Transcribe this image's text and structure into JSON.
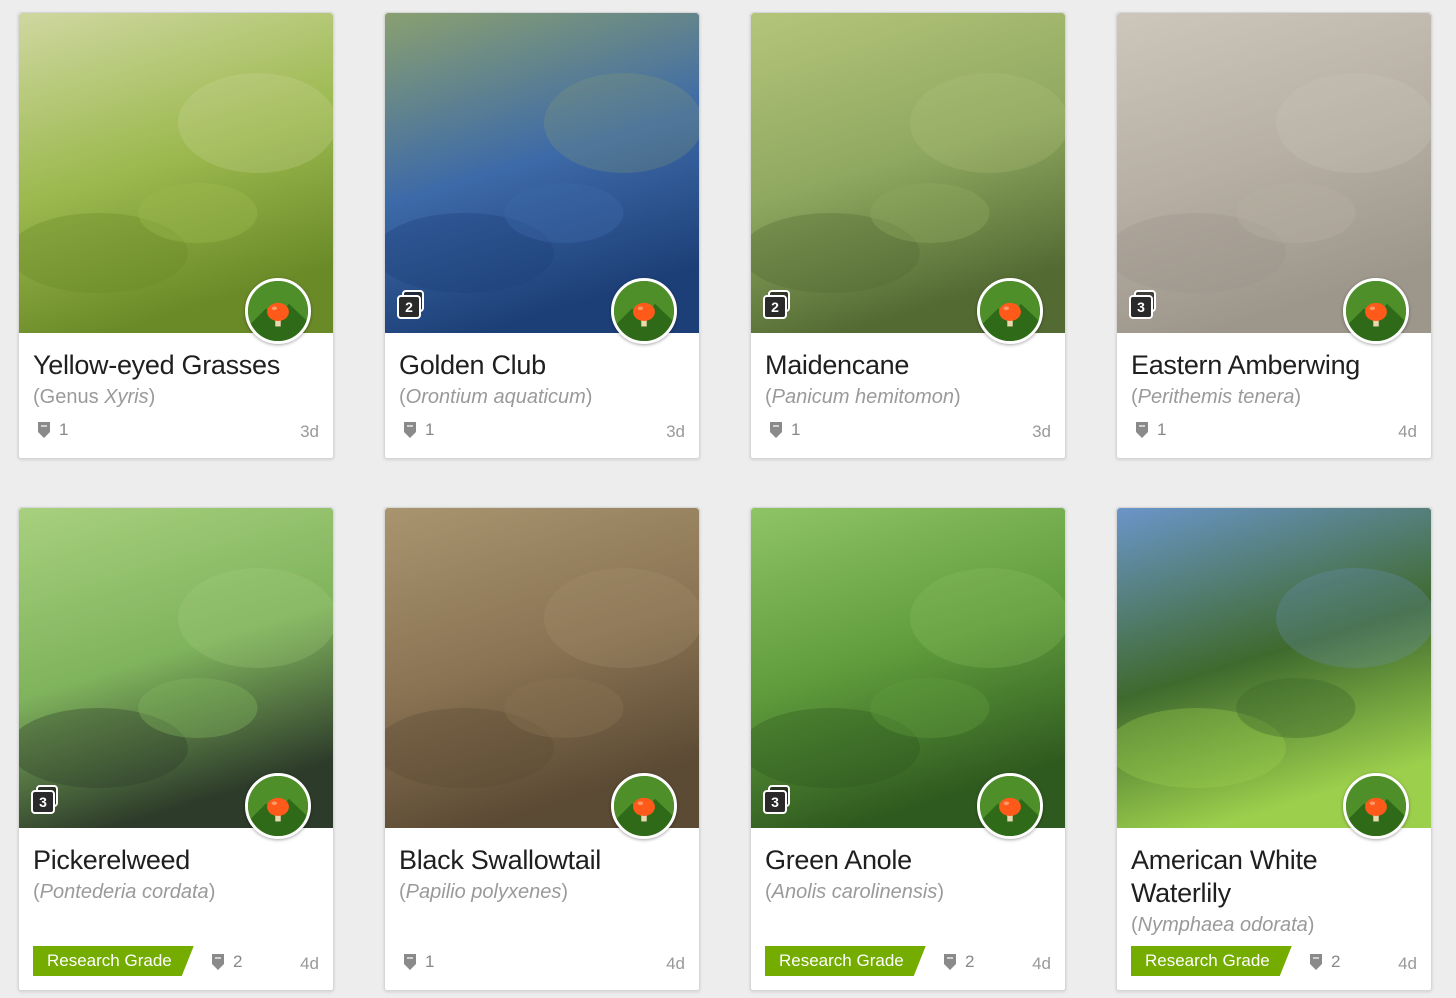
{
  "cards": [
    {
      "common_name": "Yellow-eyed Grasses",
      "sci_prefix": "(Genus ",
      "sci_name": "Xyris",
      "sci_suffix": ")",
      "photo_count": "",
      "research_grade": "",
      "identifications": "1",
      "time_ago": "3d",
      "photo_colors": [
        "#9bb94e",
        "#6a8a28",
        "#cfd7a0"
      ]
    },
    {
      "common_name": "Golden Club",
      "sci_prefix": "(",
      "sci_name": "Orontium aquaticum",
      "sci_suffix": ")",
      "photo_count": "2",
      "research_grade": "",
      "identifications": "1",
      "time_ago": "3d",
      "photo_colors": [
        "#3d6aa8",
        "#1d3f77",
        "#8aa070"
      ]
    },
    {
      "common_name": "Maidencane",
      "sci_prefix": "(",
      "sci_name": "Panicum hemitomon",
      "sci_suffix": ")",
      "photo_count": "2",
      "research_grade": "",
      "identifications": "1",
      "time_ago": "3d",
      "photo_colors": [
        "#8fa860",
        "#536b33",
        "#b4c57a"
      ]
    },
    {
      "common_name": "Eastern Amberwing",
      "sci_prefix": "(",
      "sci_name": "Perithemis tenera",
      "sci_suffix": ")",
      "photo_count": "3",
      "research_grade": "",
      "identifications": "1",
      "time_ago": "4d",
      "photo_colors": [
        "#b7afa3",
        "#9d968b",
        "#cdc6bb"
      ]
    },
    {
      "common_name": "Pickerelweed",
      "sci_prefix": "(",
      "sci_name": "Pontederia cordata",
      "sci_suffix": ")",
      "photo_count": "3",
      "research_grade": "Research Grade",
      "identifications": "2",
      "time_ago": "4d",
      "photo_colors": [
        "#7fb35c",
        "#2d3b2a",
        "#a8d07e"
      ]
    },
    {
      "common_name": "Black Swallowtail",
      "sci_prefix": "(",
      "sci_name": "Papilio polyxenes",
      "sci_suffix": ")",
      "photo_count": "",
      "research_grade": "",
      "identifications": "1",
      "time_ago": "4d",
      "photo_colors": [
        "#8a7353",
        "#5b4a34",
        "#a8956f"
      ]
    },
    {
      "common_name": "Green Anole",
      "sci_prefix": "(",
      "sci_name": "Anolis carolinensis",
      "sci_suffix": ")",
      "photo_count": "3",
      "research_grade": "Research Grade",
      "identifications": "2",
      "time_ago": "4d",
      "photo_colors": [
        "#5f9b3c",
        "#2f5a1f",
        "#8fc465"
      ]
    },
    {
      "common_name": "American White Waterlily",
      "sci_prefix": "(",
      "sci_name": "Nymphaea odorata",
      "sci_suffix": ")",
      "photo_count": "",
      "research_grade": "Research Grade",
      "identifications": "2",
      "time_ago": "4d",
      "photo_colors": [
        "#3f6a2e",
        "#9ccf4c",
        "#6b95c9"
      ]
    }
  ],
  "colors": {
    "research_grade": "#74ac00",
    "accent_orange": "#ff5a1a"
  },
  "icons": {
    "id_count": "shield-icon",
    "photo_count": "photos-stack-icon",
    "user": "avatar-mushroom"
  }
}
